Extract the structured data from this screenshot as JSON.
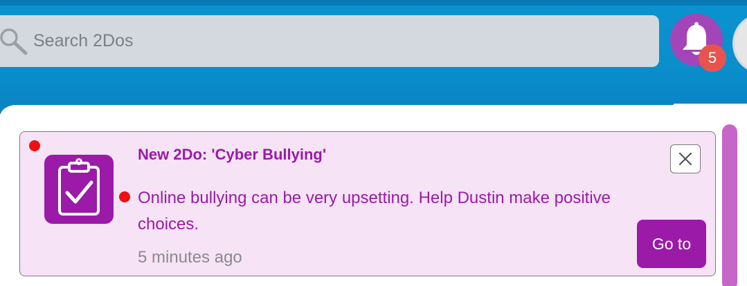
{
  "header": {
    "search": {
      "placeholder": "Search 2Dos",
      "value": "",
      "icon": "search-icon"
    },
    "notifications": {
      "icon": "bell-icon",
      "count": "5",
      "button_color": "#a345b8",
      "badge_color": "#e8534d"
    },
    "accent_color": "#0a8fcd"
  },
  "notification_panel": {
    "items": [
      {
        "icon": "clipboard-check-icon",
        "title": "New 2Do: 'Cyber Bullying'",
        "body": "Online bullying can be very upsetting. Help Dustin make positive choices.",
        "time": "5 minutes ago",
        "go_label": "Go to",
        "close_icon": "close-icon",
        "unread": true
      }
    ],
    "item_background": "#f6e3f6",
    "text_color": "#9b1aa8"
  }
}
